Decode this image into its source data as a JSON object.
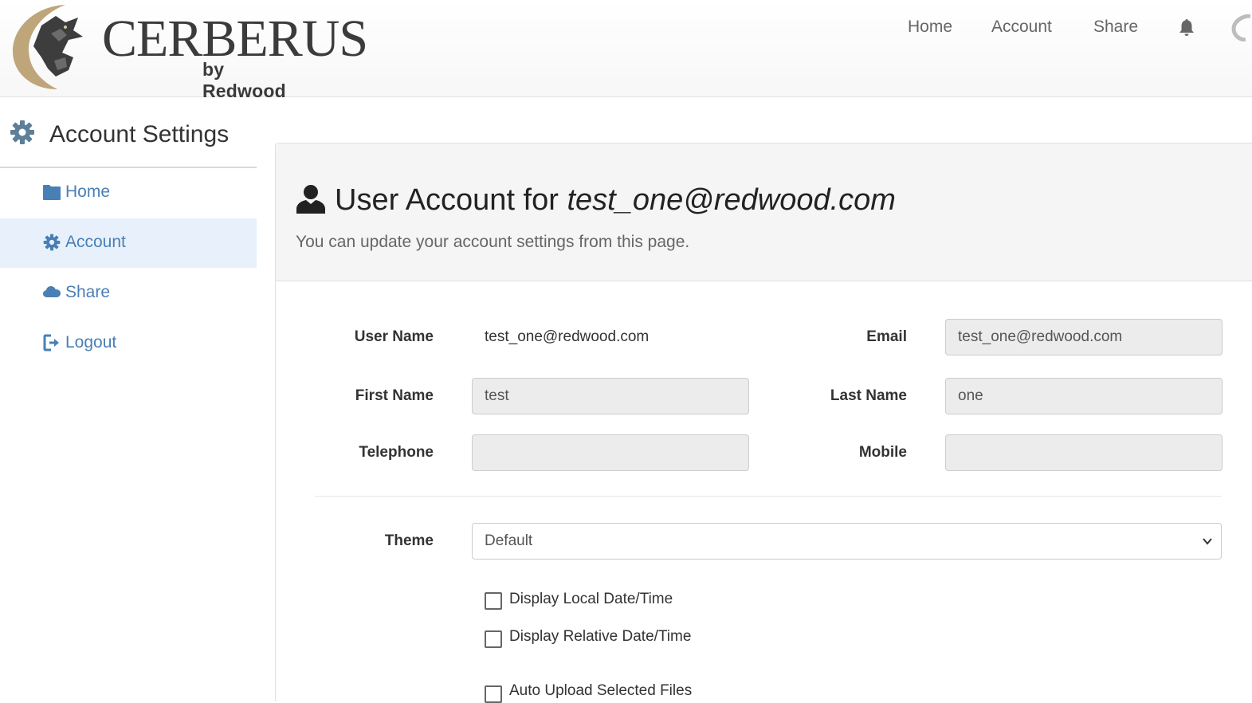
{
  "header": {
    "logo_main": "CERBERUS",
    "logo_sub": "by Redwood",
    "nav": [
      "Home",
      "Account",
      "Share"
    ],
    "bell_icon": "bell-icon",
    "avatar_icon": "user-circle-icon"
  },
  "sidebar": {
    "title": "Account Settings",
    "title_icon": "gear-icon",
    "items": [
      {
        "label": "Home",
        "icon": "folder-icon",
        "active": false
      },
      {
        "label": "Account",
        "icon": "gear-icon",
        "active": true
      },
      {
        "label": "Share",
        "icon": "cloud-icon",
        "active": false
      },
      {
        "label": "Logout",
        "icon": "sign-out-icon",
        "active": false
      }
    ]
  },
  "main": {
    "title_prefix": "User Account for ",
    "title_user": "test_one@redwood.com",
    "subtitle": "You can update your account settings from this page.",
    "fields": {
      "username_label": "User Name",
      "username_value": "test_one@redwood.com",
      "email_label": "Email",
      "email_value": "test_one@redwood.com",
      "firstname_label": "First Name",
      "firstname_value": "test",
      "lastname_label": "Last Name",
      "lastname_value": "one",
      "telephone_label": "Telephone",
      "telephone_value": "",
      "mobile_label": "Mobile",
      "mobile_value": ""
    },
    "theme_label": "Theme",
    "theme_value": "Default",
    "checkboxes": [
      {
        "label": "Display Local Date/Time",
        "checked": false
      },
      {
        "label": "Display Relative Date/Time",
        "checked": false
      },
      {
        "label": "Auto Upload Selected Files",
        "checked": false
      }
    ]
  },
  "colors": {
    "link": "#4a7fb5",
    "active_bg": "#e8f1fb",
    "panel_head_bg": "#f5f5f5"
  }
}
